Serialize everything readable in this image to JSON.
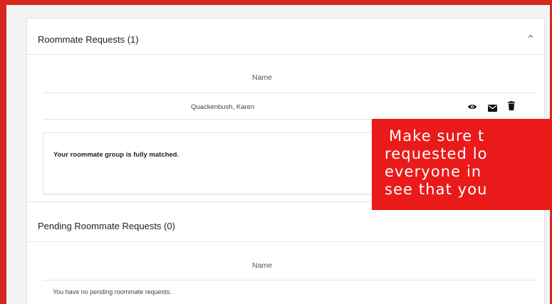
{
  "roommate_requests": {
    "title": "Roommate Requests (1)",
    "collapse_icon": "chevron-up-icon",
    "column_header": "Name",
    "rows": [
      {
        "name": "Quackenbush, Karen",
        "actions": [
          "eye-icon",
          "mail-icon",
          "trash-icon"
        ]
      }
    ],
    "status_message": "Your roommate group is fully matched."
  },
  "pending_requests": {
    "title": "Pending Roommate Requests (0)",
    "column_header": "Name",
    "empty_message": "You have no pending roommate requests."
  },
  "overlay": {
    "lines": [
      " Make sure t",
      "requested lo",
      "everyone in",
      "see that you"
    ]
  },
  "colors": {
    "border_red": "#d7281f",
    "overlay_red": "#ea1a1a",
    "page_bg": "#f4f4f4"
  }
}
